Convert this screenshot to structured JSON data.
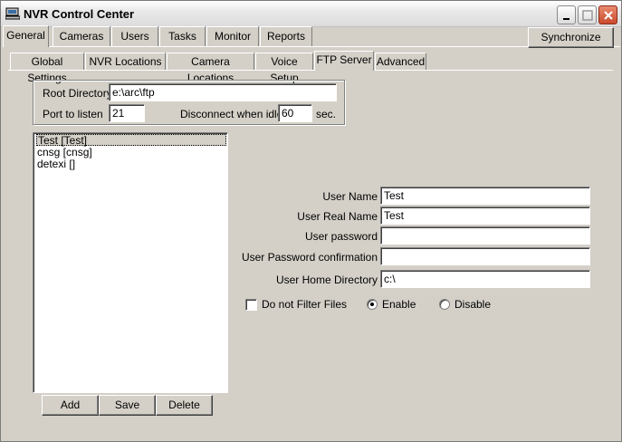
{
  "window": {
    "title": "NVR Control Center",
    "icon": "computer-icon"
  },
  "tabs": [
    {
      "label": "General",
      "active": true
    },
    {
      "label": "Cameras",
      "active": false
    },
    {
      "label": "Users",
      "active": false
    },
    {
      "label": "Tasks",
      "active": false
    },
    {
      "label": "Monitor",
      "active": false
    },
    {
      "label": "Reports",
      "active": false
    }
  ],
  "toolbar": {
    "synchronize_label": "Synchronize"
  },
  "subtabs": [
    {
      "label": "Global Settings",
      "active": false
    },
    {
      "label": "NVR Locations",
      "active": false
    },
    {
      "label": "Camera Locations",
      "active": false
    },
    {
      "label": "Voice Setup",
      "active": false
    },
    {
      "label": "FTP Server",
      "active": true
    },
    {
      "label": "Advanced",
      "active": false
    }
  ],
  "ftp": {
    "root_directory_label": "Root Directory",
    "root_directory_value": "e:\\arc\\ftp",
    "port_label": "Port to listen",
    "port_value": "21",
    "idle_label": "Disconnect when idle",
    "idle_value": "60",
    "idle_unit": "sec."
  },
  "users_list": [
    {
      "text": "Test [Test]",
      "selected": true
    },
    {
      "text": "cnsg [cnsg]",
      "selected": false
    },
    {
      "text": "detexi []",
      "selected": false
    }
  ],
  "list_buttons": {
    "add": "Add",
    "save": "Save",
    "delete": "Delete"
  },
  "user_form": {
    "user_name_label": "User Name",
    "user_name_value": "Test",
    "real_name_label": "User Real Name",
    "real_name_value": "Test",
    "password_label": "User password",
    "password_value": "",
    "password_confirm_label": "User Password confirmation",
    "password_confirm_value": "",
    "home_dir_label": "User Home Directory",
    "home_dir_value": "c:\\",
    "no_filter_label": "Do not Filter Files",
    "no_filter_checked": false,
    "enable_label": "Enable",
    "disable_label": "Disable",
    "status_selected": "Enable"
  }
}
